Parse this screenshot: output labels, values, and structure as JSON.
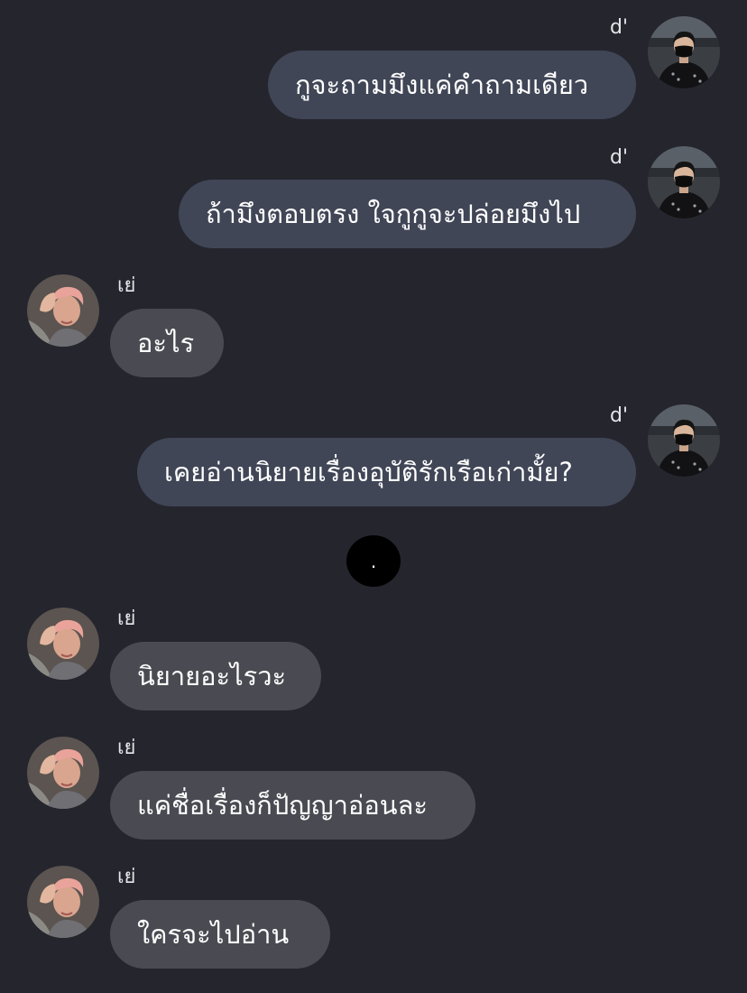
{
  "chat": {
    "messages": [
      {
        "sender": "d'",
        "side": "right",
        "text": "กูจะถามมึงแค่คำถามเดียว"
      },
      {
        "sender": "d'",
        "side": "right",
        "text": "ถ้ามึงตอบตรง ใจกูกูจะปล่อยมึงไป"
      },
      {
        "sender": "เย่",
        "side": "left",
        "text": "อะไร"
      },
      {
        "sender": "d'",
        "side": "right",
        "text": "เคยอ่านนิยายเรื่องอุบัติรักเรือเก่ามั้ย?"
      },
      {
        "sender": "เย่",
        "side": "left",
        "text": "นิยายอะไรวะ"
      },
      {
        "sender": "เย่",
        "side": "left",
        "text": "แค่ชื่อเรื่องก็ปัญญาอ่อนละ"
      },
      {
        "sender": "เย่",
        "side": "left",
        "text": "ใครจะไปอ่าน"
      }
    ],
    "divider": "."
  },
  "avatars": {
    "d_icon": "masked-man-avatar-icon",
    "ye_icon": "pink-hair-person-avatar-icon"
  },
  "colors": {
    "background": "#25252e",
    "bubble_right": "#404656",
    "bubble_left": "#4a4b52"
  }
}
